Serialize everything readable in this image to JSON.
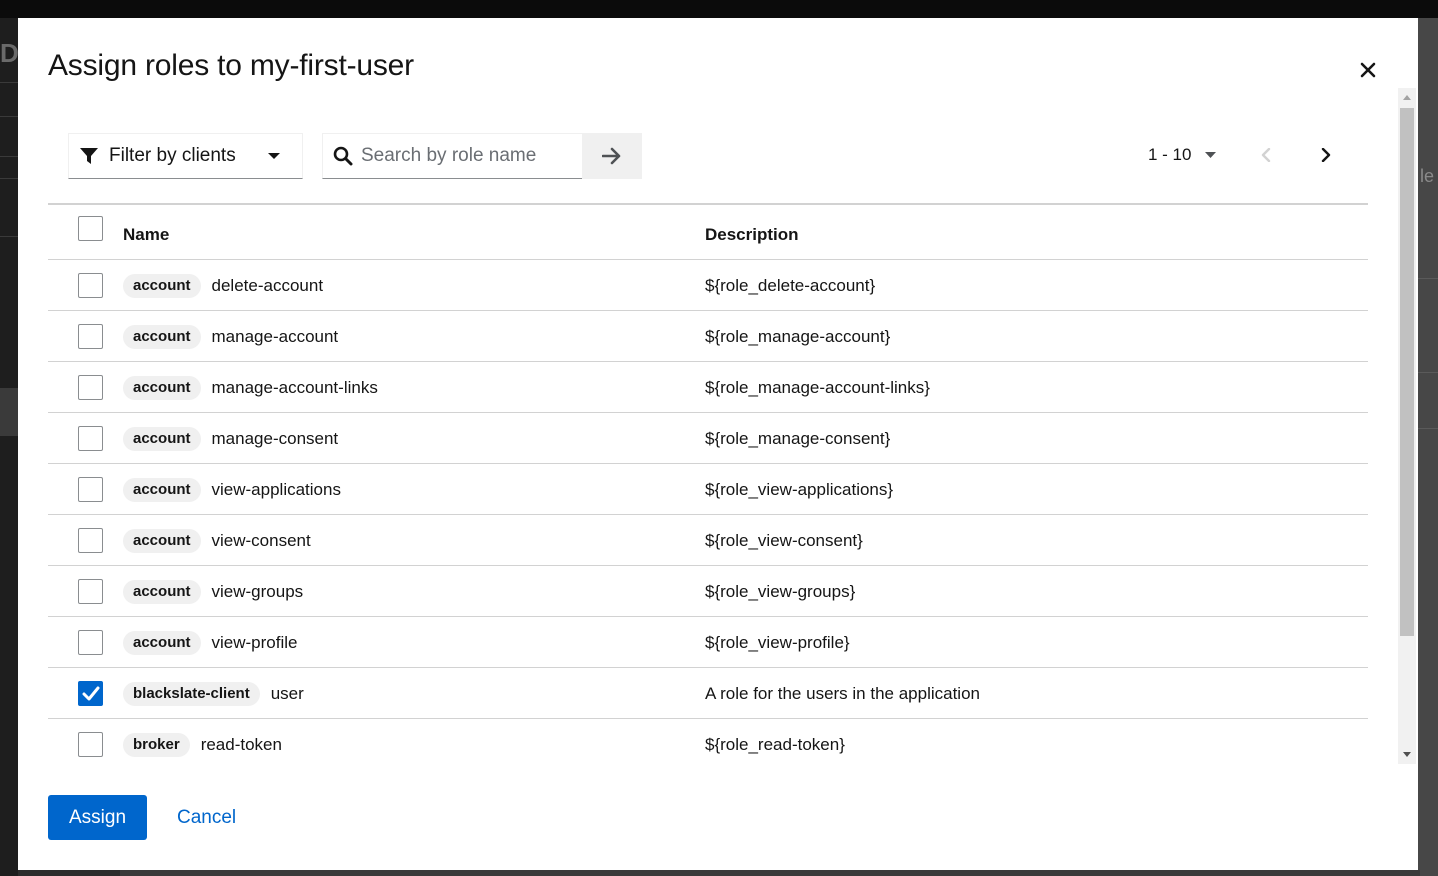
{
  "background": {
    "logo_fragment": "DA",
    "right_fragment": "le"
  },
  "modal": {
    "title": "Assign roles to my-first-user",
    "close_icon": "close-icon"
  },
  "toolbar": {
    "filter_label": "Filter by clients",
    "search_placeholder": "Search by role name",
    "search_value": "",
    "pagination_range": "1 - 10"
  },
  "table": {
    "columns": [
      "Name",
      "Description"
    ],
    "rows": [
      {
        "client": "account",
        "role": "delete-account",
        "description": "${role_delete-account}",
        "checked": false
      },
      {
        "client": "account",
        "role": "manage-account",
        "description": "${role_manage-account}",
        "checked": false
      },
      {
        "client": "account",
        "role": "manage-account-links",
        "description": "${role_manage-account-links}",
        "checked": false
      },
      {
        "client": "account",
        "role": "manage-consent",
        "description": "${role_manage-consent}",
        "checked": false
      },
      {
        "client": "account",
        "role": "view-applications",
        "description": "${role_view-applications}",
        "checked": false
      },
      {
        "client": "account",
        "role": "view-consent",
        "description": "${role_view-consent}",
        "checked": false
      },
      {
        "client": "account",
        "role": "view-groups",
        "description": "${role_view-groups}",
        "checked": false
      },
      {
        "client": "account",
        "role": "view-profile",
        "description": "${role_view-profile}",
        "checked": false
      },
      {
        "client": "blackslate-client",
        "role": "user",
        "description": "A role for the users in the application",
        "checked": true
      },
      {
        "client": "broker",
        "role": "read-token",
        "description": "${role_read-token}",
        "checked": false
      }
    ]
  },
  "footer": {
    "assign_label": "Assign",
    "cancel_label": "Cancel"
  },
  "colors": {
    "primary": "#0066cc",
    "chip_bg": "#f0f0f0",
    "border": "#d2d2d2"
  }
}
